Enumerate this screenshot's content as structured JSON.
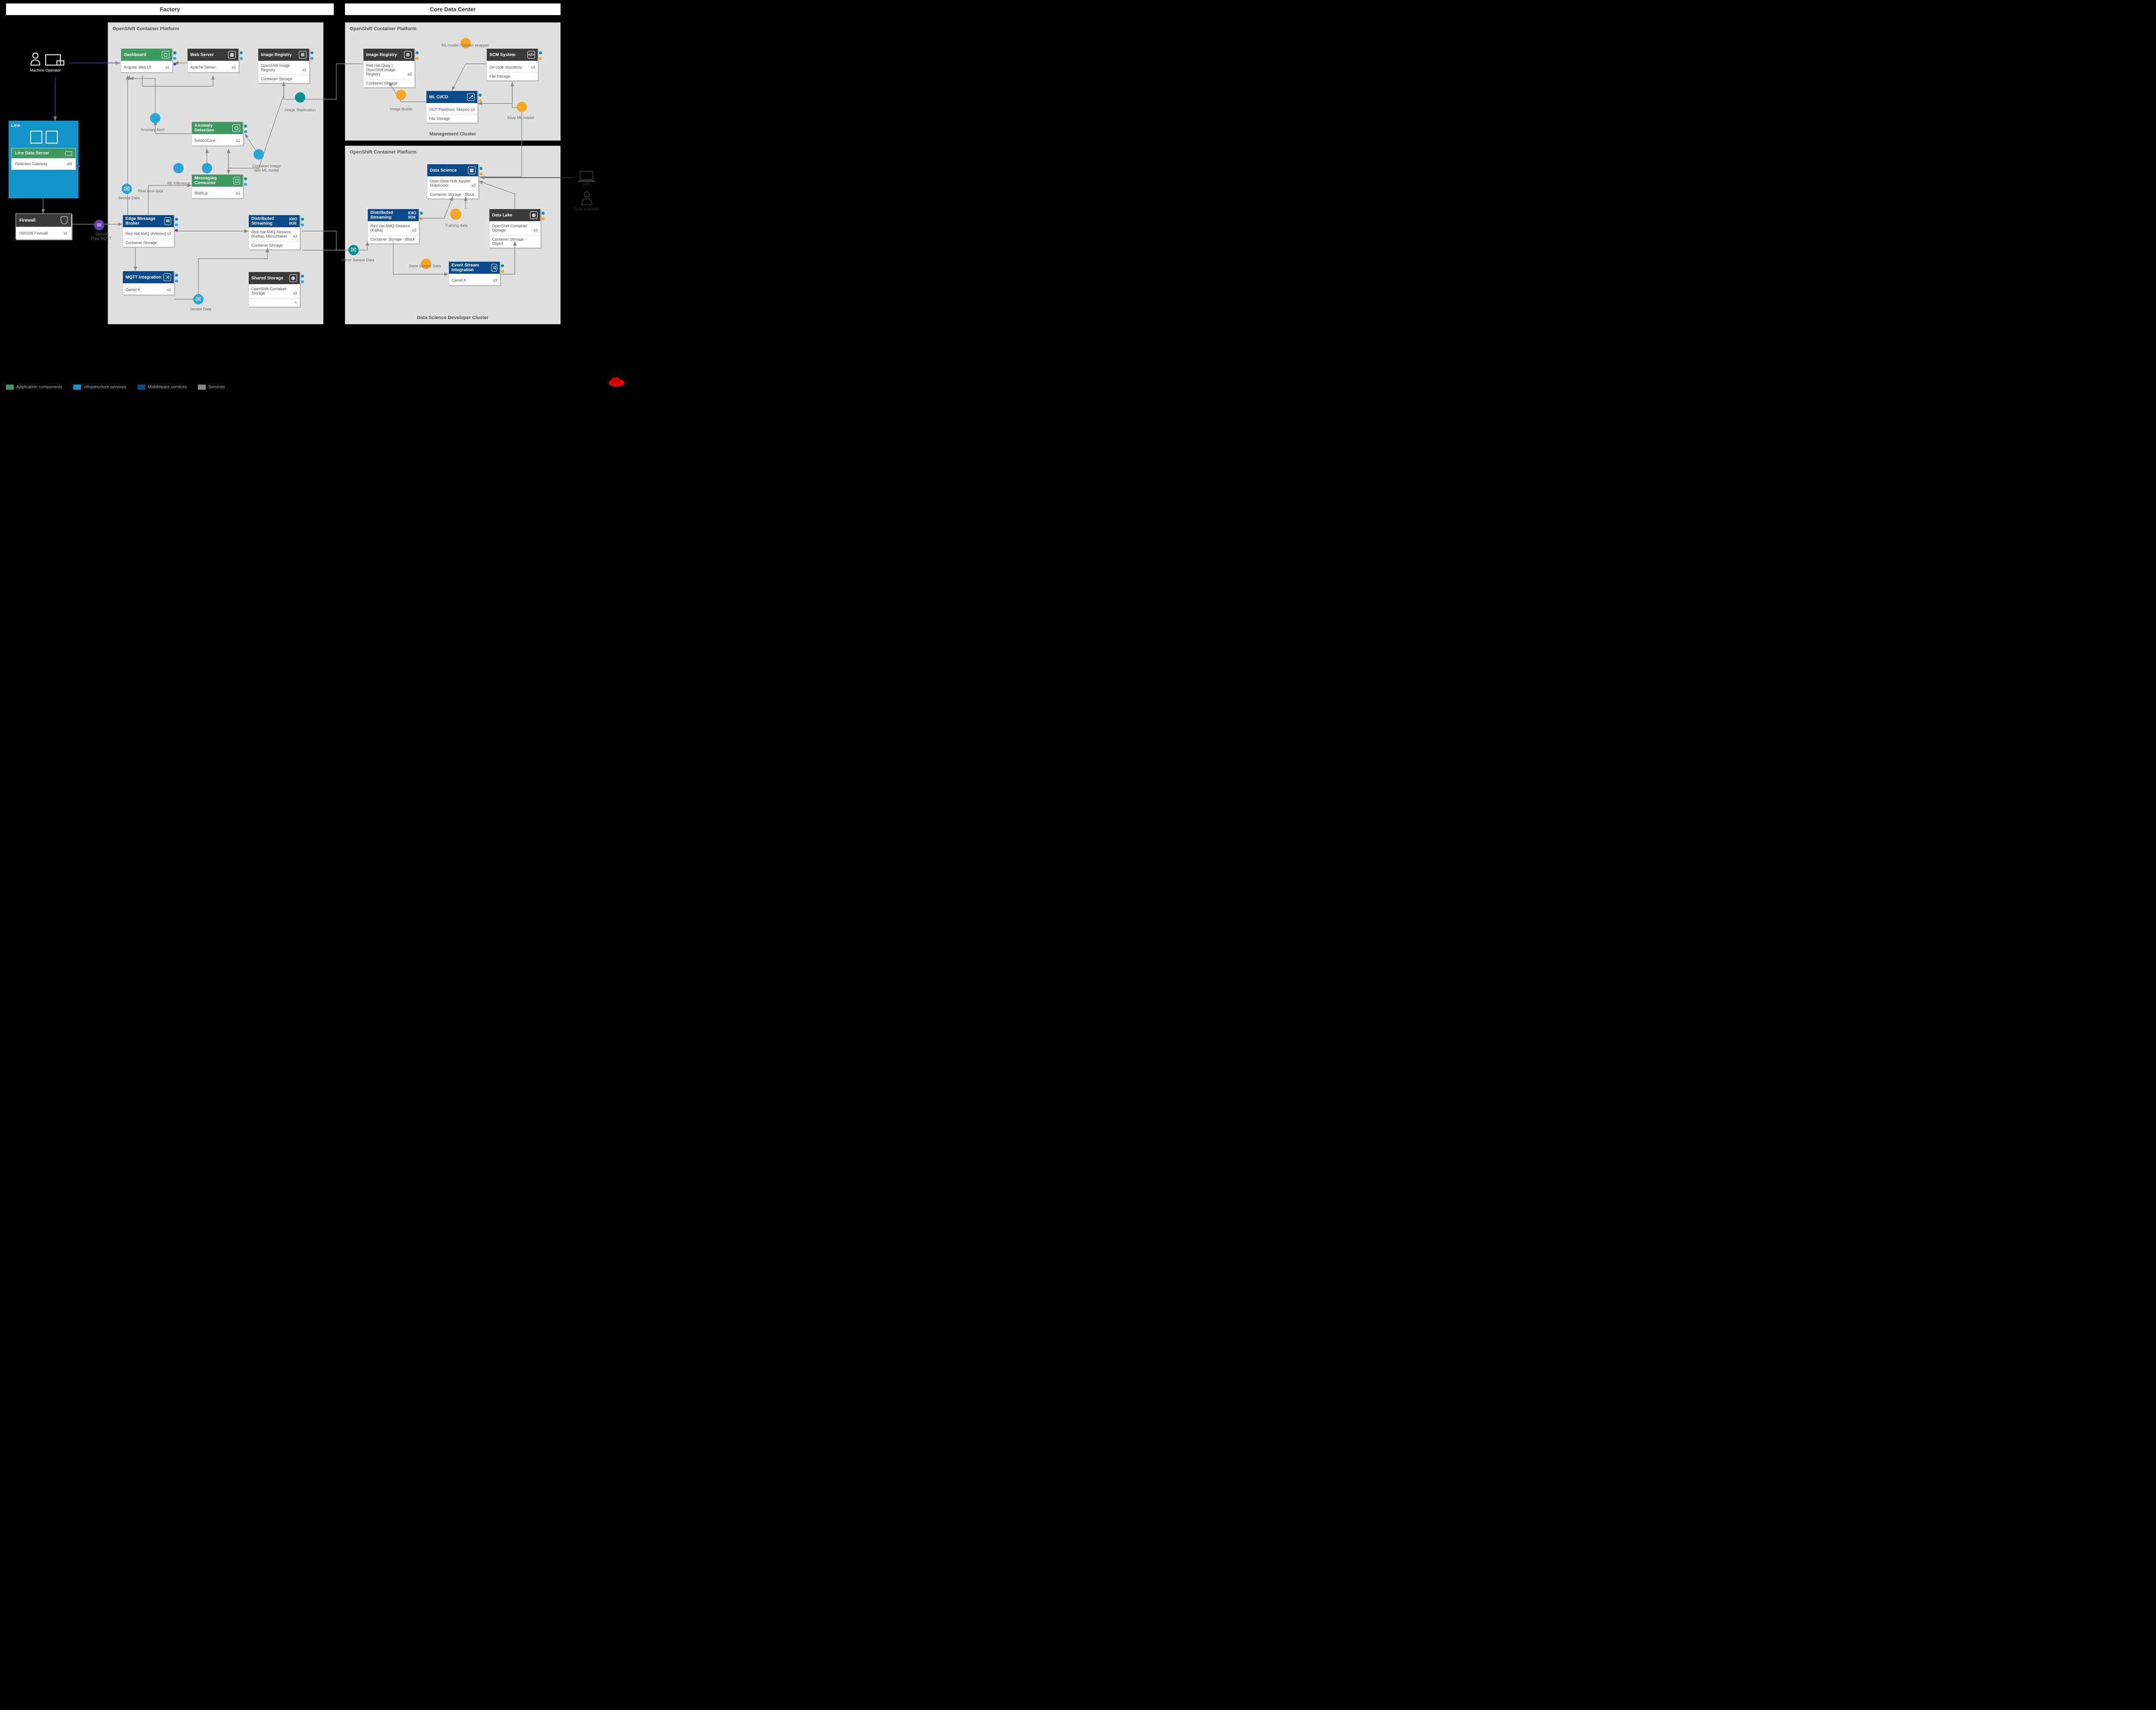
{
  "zones": {
    "factory": "Factory",
    "core": "Core Data Center"
  },
  "ocp_title": "OpenShift Container Platform",
  "clusters": {
    "mgmt": "Management Cluster",
    "ds": "Data Science Developer Cluster"
  },
  "actors": {
    "operator": "Machine Operator",
    "ide": "IDE",
    "ds": "Data scientists"
  },
  "line": {
    "title": "Line",
    "server": "Line Data Server",
    "body": "Field-bus Gateway",
    "count": "xN"
  },
  "firewall": {
    "title": "Firewall",
    "body": "HW/SW Firewall",
    "count": "x1"
  },
  "cards": {
    "dashboard": {
      "title": "Dashboard",
      "body": "Angular Web UI",
      "count": "x1"
    },
    "webserver": {
      "title": "Web Server",
      "body": "Apache Server",
      "count": "x1"
    },
    "imgreg_f": {
      "title": "Image Registry",
      "body": "OpenShift Image Registry",
      "count": "x1",
      "foot": "Container Storage"
    },
    "anomaly": {
      "title": "Anomaly Detection",
      "body": "SeldonCore",
      "count": "x1"
    },
    "consumer": {
      "title": "Messaging Consumer",
      "body": "Node.js",
      "count": "x1"
    },
    "edgebroker": {
      "title": "Edge Message Broker",
      "body": "Red Hat AMQ (Artemis)",
      "count": "x3",
      "foot": "Container Storage"
    },
    "diststream_f": {
      "title": "Distributed Streaming",
      "body": "Red Hat AMQ Streams (Kafka), MirrorMaker",
      "count": "x3",
      "foot": "Container Storage"
    },
    "mqtt": {
      "title": "MQTT Integration",
      "body": "Camel K",
      "count": "x1"
    },
    "sharedstor": {
      "title": "Shared Storage",
      "body": "OpenShift Container Storage",
      "count": "x3"
    },
    "imgreg_c": {
      "title": "Image Registry",
      "body": "Red Hat Quay | OpenShift Image Registry",
      "count": "x3",
      "foot": "Container Storage"
    },
    "scm": {
      "title": "SCM System",
      "body": "Git code repository",
      "count": "x3",
      "foot": "File Storage"
    },
    "mlcicd": {
      "title": "ML CI/CD",
      "body": "OCP Pipelines, Skopeo",
      "count": "x3",
      "foot": "File Storage"
    },
    "datasci": {
      "title": "Data Science",
      "body": "Open Data Hub Jupyter Notebooks",
      "count": "x3",
      "foot": "Container Storage - Block"
    },
    "datalake": {
      "title": "Data Lake",
      "body": "OpenShift Container Storage",
      "count": "x3",
      "foot": "Container Storage - Object"
    },
    "diststream_c": {
      "title": "Distributed Streaming",
      "body": "Red Hat AMQ Streams (Kafka)",
      "count": "x3",
      "foot": "Container Storage - Block"
    },
    "eventint": {
      "title": "Event Stream Integration",
      "body": "Camel K",
      "count": "x3"
    }
  },
  "edge_labels": {
    "anomaly_alert": "Anomaly Alert",
    "ml_inference": "ML Inference",
    "real_time_data": "Real time data",
    "sensor_data": "Sensor Data",
    "sensor_data2": "Sensor Data",
    "container_image": "Container image with ML model",
    "image_replication": "Image Replication",
    "sensor_mqtt": "Sensor Data MQTT",
    "mirror_sensor": "Mirror Sensor Data",
    "image_builds": "Image Builds",
    "ml_model_wrapper": "ML model / Seldon wrapper",
    "save_ml_model": "Save ML model",
    "training_data": "Training data",
    "store_sensor": "Store Sensor Data"
  },
  "legend": {
    "app": {
      "label": "Application components",
      "color": "#3e9b5f"
    },
    "infra": {
      "label": "Infrastructure services",
      "color": "#1296c9"
    },
    "mw": {
      "label": "Middleware services",
      "color": "#0b4a8b"
    },
    "svc": {
      "label": "Services",
      "color": "#888888"
    }
  }
}
